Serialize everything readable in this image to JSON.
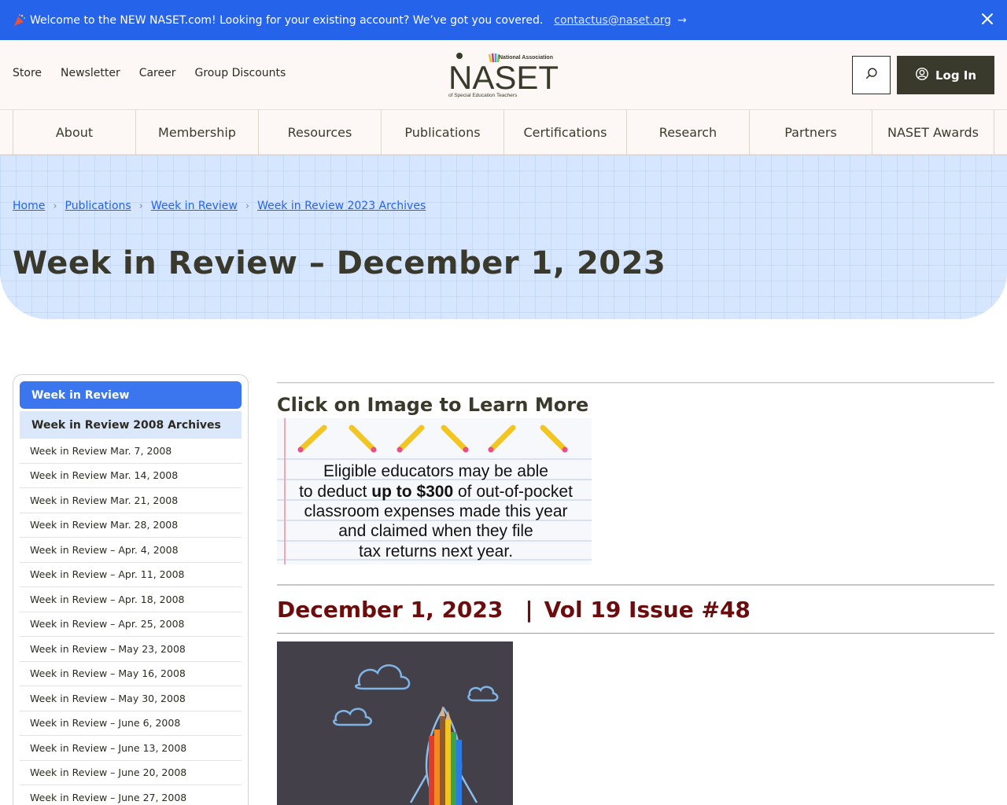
{
  "announcement": {
    "message": "Welcome to the NEW NASET.com! Looking for your existing account? We’ve got you covered.",
    "email": "contactus@naset.org",
    "icon": "party-popper-icon",
    "close_icon": "close-icon",
    "color": "#2563eb"
  },
  "header": {
    "utility_links": [
      "Store",
      "Newsletter",
      "Career",
      "Group Discounts"
    ],
    "logo": {
      "wordmark": "NASET",
      "top_text": "National Association",
      "bottom_text": "of Special Education Teachers"
    },
    "search_icon": "search-icon",
    "login_label": "Log In",
    "login_icon": "user-circle-icon"
  },
  "main_nav": [
    "About",
    "Membership",
    "Resources",
    "Publications",
    "Certifications",
    "Research",
    "Partners",
    "NASET Awards"
  ],
  "breadcrumb": [
    "Home",
    "Publications",
    "Week in Review",
    "Week in Review 2023 Archives"
  ],
  "page_title": "Week in Review – December 1, 2023",
  "sidebar": {
    "heading": "Week in Review",
    "subheading": "Week in Review 2008 Archives",
    "items": [
      "Week in Review Mar. 7, 2008",
      "Week in Review Mar. 14, 2008",
      "Week in Review Mar. 21, 2008",
      "Week in Review Mar. 28, 2008",
      "Week in Review – Apr. 4, 2008",
      "Week in Review – Apr. 11, 2008",
      "Week in Review – Apr. 18, 2008",
      "Week in Review – Apr. 25, 2008",
      "Week in Review – May 23, 2008",
      "Week in Review – May 16, 2008",
      "Week in Review – May 30, 2008",
      "Week in Review – June 6, 2008",
      "Week in Review – June 13, 2008",
      "Week in Review – June 20, 2008",
      "Week in Review – June 27, 2008"
    ]
  },
  "content": {
    "promo_title": "Click on Image to Learn More",
    "promo_image": {
      "line1": "Eligible educators may be able",
      "line2_pre": "to deduct ",
      "line2_bold": "up to $300",
      "line2_post": " of out-of-pocket",
      "line3": "classroom expenses made this year",
      "line4": "and claimed when they file",
      "line5": "tax returns next year."
    },
    "issue_date": "December 1, 2023",
    "issue_separator": "|",
    "issue_volume": "Vol 19 Issue #48",
    "issue_color": "#6b0d0d"
  }
}
